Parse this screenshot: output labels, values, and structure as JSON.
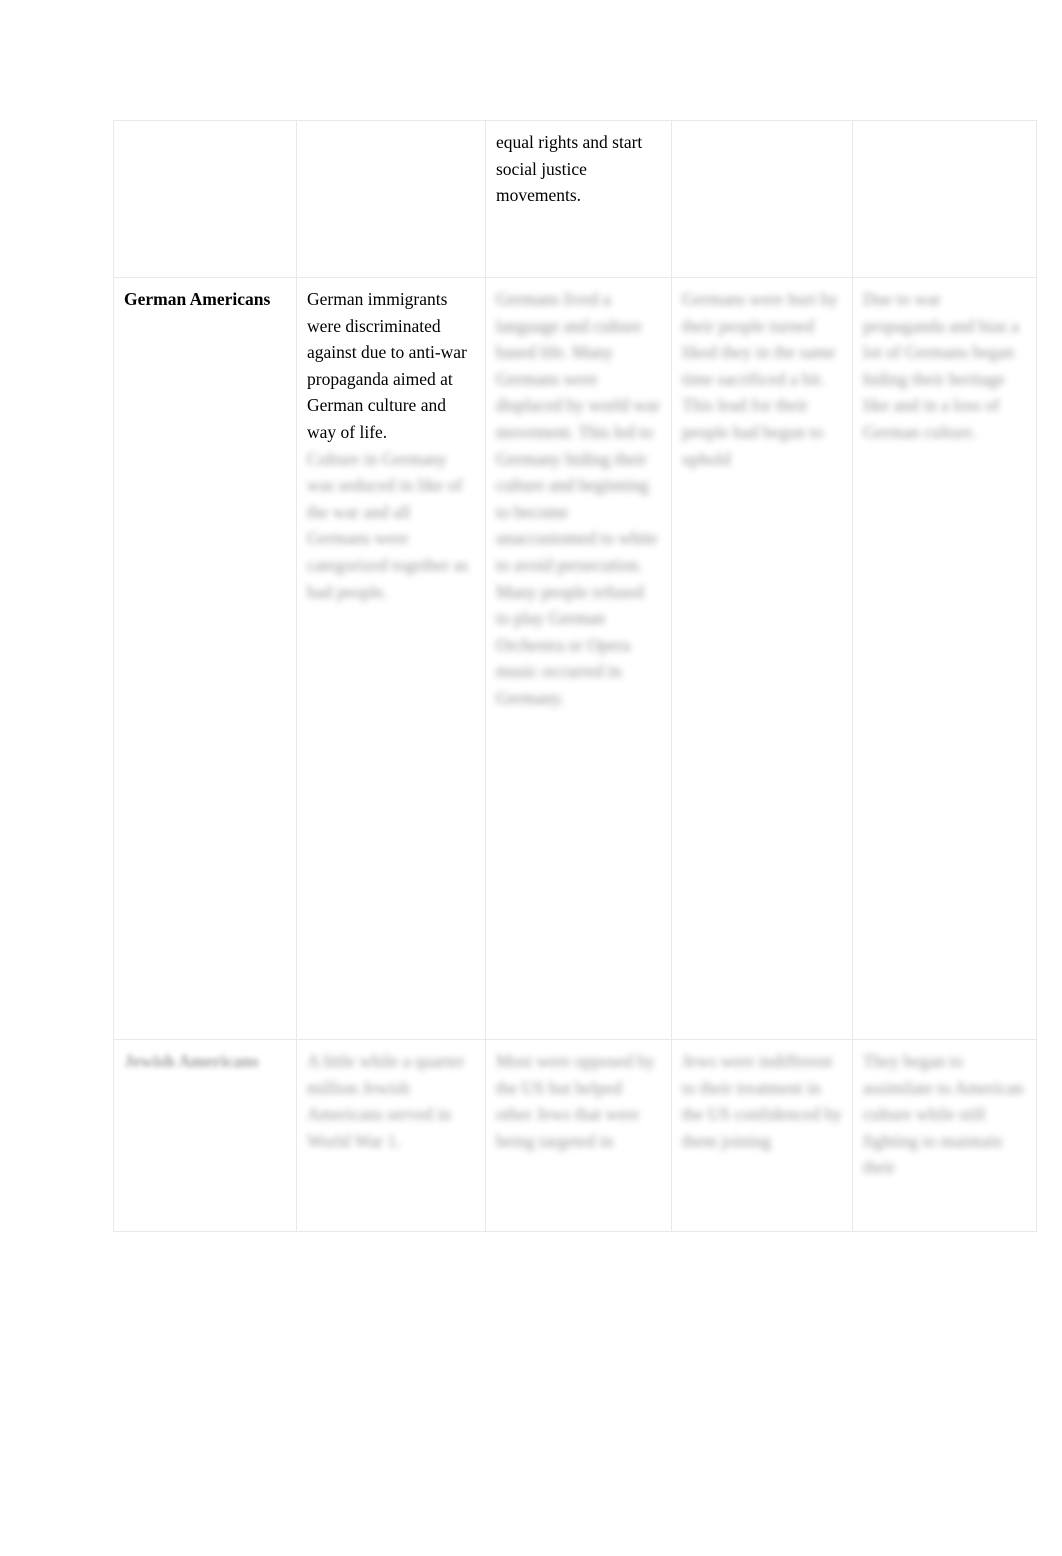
{
  "document": {
    "page_background": "#ffffff",
    "text_color": "#000000",
    "border_color": "#e9e9e9"
  },
  "table": {
    "columns": 5,
    "rows": [
      {
        "row_name": "row-top-partial",
        "cells": [
          {
            "text": "",
            "blurred": false,
            "bold": false
          },
          {
            "text": "",
            "blurred": false,
            "bold": false
          },
          {
            "text": "equal rights and start social justice movements.",
            "blurred": false,
            "bold": false
          },
          {
            "text": "",
            "blurred": false,
            "bold": false
          },
          {
            "text": "",
            "blurred": false,
            "bold": false
          }
        ]
      },
      {
        "row_name": "row-german-americans",
        "cells": [
          {
            "text": "German Americans",
            "blurred": false,
            "bold": true
          },
          {
            "text": "German immigrants were discriminated against due to anti-war propaganda aimed at German culture and way of life.",
            "blurred": false,
            "bold": false
          },
          {
            "text": "Germans lived a language and culture based life. Many Germans were displaced by world war movement. This led to Germany hiding their culture and beginning to become unaccustomed to white to avoid persecution. Many people refused to play German Orchestra or Opera music occurred in Germany.",
            "blurred": true,
            "bold": false
          },
          {
            "text": "Germans were hurt by their people turned liked they in the same time sacrificed a bit. This lead for their people had begun to uphold",
            "blurred": true,
            "bold": false
          },
          {
            "text": "Due to war propaganda and bias a lot of Germans began hiding their heritage like and in a loss of German culture.",
            "blurred": true,
            "bold": false
          }
        ]
      },
      {
        "row_name": "row-bottom-partial",
        "cells": [
          {
            "text": "Jewish Americans",
            "blurred": true,
            "bold": true
          },
          {
            "text": "A little while a quarter million Jewish Americans served in World War 1.",
            "blurred": true,
            "bold": false
          },
          {
            "text": "Most were opposed by the US but helped other Jews that were being targeted in",
            "blurred": true,
            "bold": false
          },
          {
            "text": "Jews were indifferent to their treatment in the US confidenced by them joining",
            "blurred": true,
            "bold": false
          },
          {
            "text": "They began to assimilate to American culture while still fighting to maintain their",
            "blurred": true,
            "bold": false
          }
        ]
      }
    ]
  },
  "secondary_cells": {
    "r2c2_blurred_continuation": "Culture in Germany was seduced in like of the war and all Germans were categorized together as bad people."
  }
}
